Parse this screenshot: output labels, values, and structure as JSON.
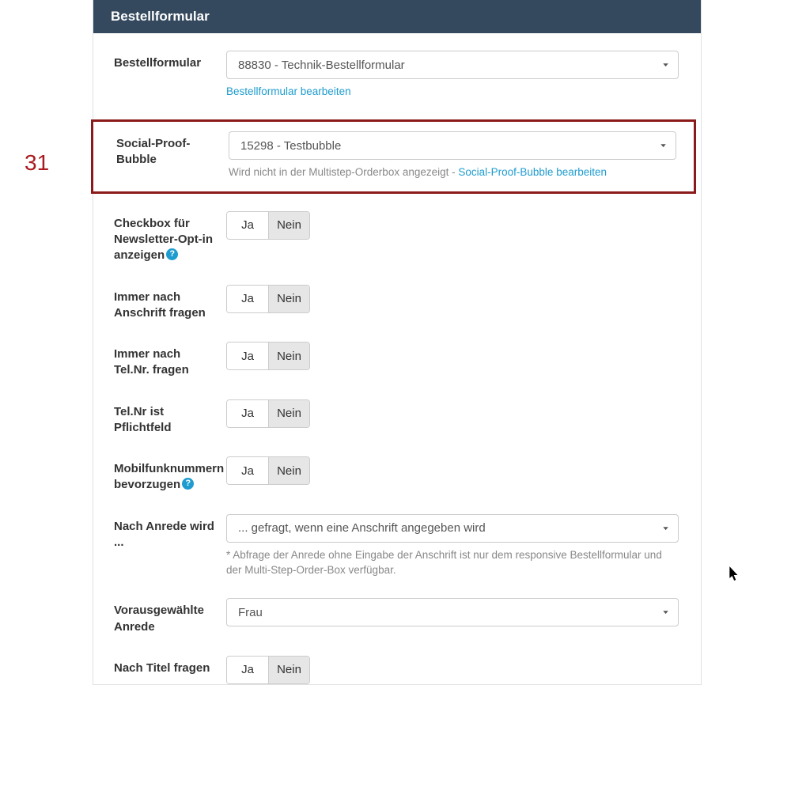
{
  "annotation": "31",
  "panel": {
    "title": "Bestellformular"
  },
  "form": {
    "bestellformular": {
      "label": "Bestellformular",
      "selected": "88830 - Technik-Bestellformular",
      "edit_link": "Bestellformular bearbeiten"
    },
    "social_proof": {
      "label": "Social-Proof-Bubble",
      "selected": "15298 - Testbubble",
      "hint_pre": "Wird nicht in der Multistep-Orderbox angezeigt - ",
      "edit_link": "Social-Proof-Bubble bearbeiten"
    },
    "newsletter_optin": {
      "label": "Checkbox für Newsletter-Opt-in anzeigen",
      "ja": "Ja",
      "nein": "Nein"
    },
    "anschrift": {
      "label": "Immer nach Anschrift fragen",
      "ja": "Ja",
      "nein": "Nein"
    },
    "telnr": {
      "label": "Immer nach Tel.Nr. fragen",
      "ja": "Ja",
      "nein": "Nein"
    },
    "telnr_req": {
      "label": "Tel.Nr ist Pflichtfeld",
      "ja": "Ja",
      "nein": "Nein"
    },
    "mobil": {
      "label": "Mobilfunknummern bevorzugen",
      "ja": "Ja",
      "nein": "Nein"
    },
    "anrede": {
      "label": "Nach Anrede wird ...",
      "selected": "... gefragt, wenn eine Anschrift angegeben wird",
      "hint": "* Abfrage der Anrede ohne Eingabe der Anschrift ist nur dem responsive Bestellformular und der Multi-Step-Order-Box verfügbar."
    },
    "vor_anrede": {
      "label": "Vorausgewählte Anrede",
      "selected": "Frau"
    },
    "titel": {
      "label": "Nach Titel fragen",
      "ja": "Ja",
      "nein": "Nein"
    }
  }
}
